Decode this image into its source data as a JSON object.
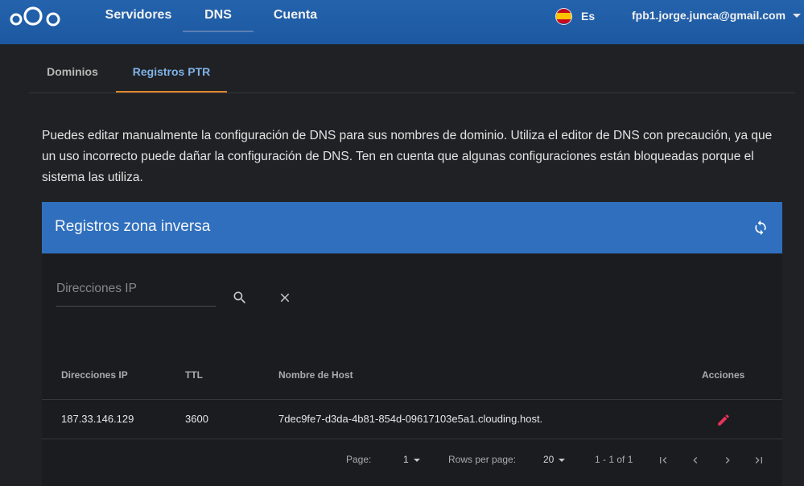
{
  "topbar": {
    "nav": [
      "Servidores",
      "DNS",
      "Cuenta"
    ],
    "lang": "Es",
    "user": "fpb1.jorge.junca@gmail.com"
  },
  "tabs": [
    "Dominios",
    "Registros PTR"
  ],
  "intro": "Puedes editar manualmente la configuración de DNS para sus nombres de dominio. Utiliza el editor de DNS con precaución, ya que un uso incorrecto puede dañar la configuración de DNS. Ten en cuenta que algunas configuraciones están bloqueadas porque el sistema las utiliza.",
  "card": {
    "title": "Registros zona inversa",
    "search_placeholder": "Direcciones IP",
    "columns": [
      "Direcciones IP",
      "TTL",
      "Nombre de Host",
      "Acciones"
    ],
    "rows": [
      {
        "ip": "187.33.146.129",
        "ttl": "3600",
        "host": "7dec9fe7-d3da-4b81-854d-09617103e5a1.clouding.host."
      }
    ],
    "pager": {
      "page_label": "Page:",
      "page_value": "1",
      "rows_label": "Rows per page:",
      "rows_value": "20",
      "range": "1 - 1 of 1"
    }
  },
  "colors": {
    "accent": "#2f6fbd",
    "tab_active": "#7fb3e8",
    "tab_underline": "#e0852e",
    "edit_icon": "#e8335b"
  },
  "icons": [
    "nextcloud-logo-icon",
    "spain-flag-icon",
    "refresh-icon",
    "search-icon",
    "clear-icon",
    "edit-icon",
    "first-page-icon",
    "prev-page-icon",
    "next-page-icon",
    "last-page-icon"
  ]
}
